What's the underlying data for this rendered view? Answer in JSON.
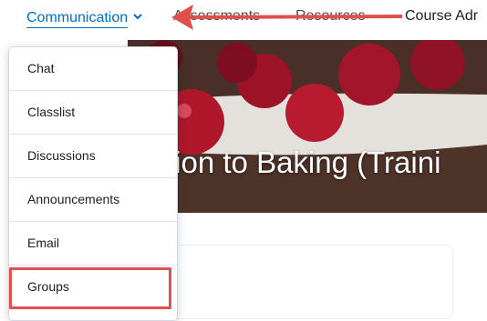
{
  "nav": {
    "communication_label": "Communication",
    "assessments_label": "Assessments",
    "resources_label": "Resources",
    "course_admin_label": "Course Adr"
  },
  "banner": {
    "title": "tion to Baking (Traini"
  },
  "dropdown": {
    "items": [
      {
        "label": "Chat"
      },
      {
        "label": "Classlist"
      },
      {
        "label": "Discussions"
      },
      {
        "label": "Announcements"
      },
      {
        "label": "Email"
      },
      {
        "label": "Groups"
      }
    ]
  },
  "colors": {
    "link": "#006fbf",
    "highlight": "#e05252"
  },
  "icons": {
    "chevron": "chevron-down-icon",
    "annotation": "arrow-annotation"
  }
}
